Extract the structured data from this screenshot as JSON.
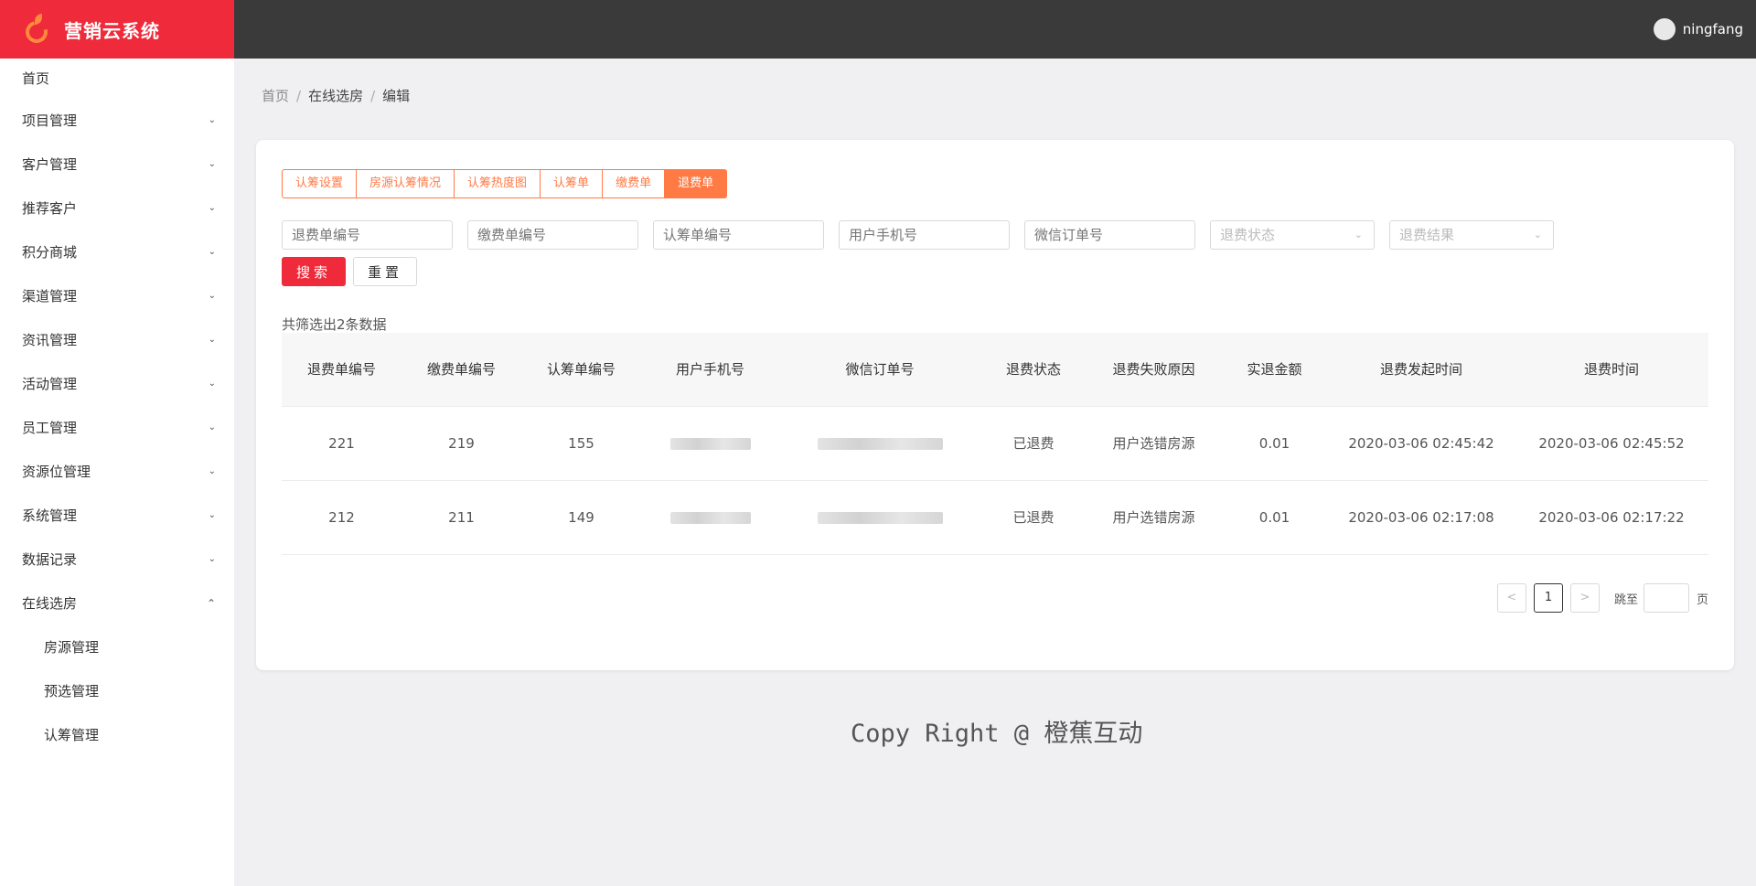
{
  "app": {
    "title": "营销云系统"
  },
  "user": {
    "name": "ningfang"
  },
  "sidebar": {
    "items": [
      {
        "label": "首页"
      },
      {
        "label": "项目管理"
      },
      {
        "label": "客户管理"
      },
      {
        "label": "推荐客户"
      },
      {
        "label": "积分商城"
      },
      {
        "label": "渠道管理"
      },
      {
        "label": "资讯管理"
      },
      {
        "label": "活动管理"
      },
      {
        "label": "员工管理"
      },
      {
        "label": "资源位管理"
      },
      {
        "label": "系统管理"
      },
      {
        "label": "数据记录"
      },
      {
        "label": "在线选房"
      }
    ],
    "subitems": [
      {
        "label": "房源管理"
      },
      {
        "label": "预选管理"
      },
      {
        "label": "认筹管理"
      }
    ]
  },
  "breadcrumb": {
    "home": "首页",
    "section": "在线选房",
    "current": "编辑",
    "sep": "/"
  },
  "tabs": [
    {
      "label": "认筹设置"
    },
    {
      "label": "房源认筹情况"
    },
    {
      "label": "认筹热度图"
    },
    {
      "label": "认筹单"
    },
    {
      "label": "缴费单"
    },
    {
      "label": "退费单"
    }
  ],
  "filters": {
    "refund_no": "退费单编号",
    "payment_no": "缴费单编号",
    "subscription_no": "认筹单编号",
    "phone": "用户手机号",
    "wechat_order": "微信订单号",
    "refund_status": "退费状态",
    "refund_result": "退费结果"
  },
  "buttons": {
    "search": "搜索",
    "reset": "重置"
  },
  "summary": "共筛选出2条数据",
  "table": {
    "headers": [
      "退费单编号",
      "缴费单编号",
      "认筹单编号",
      "用户手机号",
      "微信订单号",
      "退费状态",
      "退费失败原因",
      "实退金额",
      "退费发起时间",
      "退费时间"
    ],
    "rows": [
      {
        "refund_no": "221",
        "payment_no": "219",
        "subscription_no": "155",
        "status": "已退费",
        "reason": "用户选错房源",
        "amount": "0.01",
        "start_time": "2020-03-06 02:45:42",
        "refund_time": "2020-03-06 02:45:52"
      },
      {
        "refund_no": "212",
        "payment_no": "211",
        "subscription_no": "149",
        "status": "已退费",
        "reason": "用户选错房源",
        "amount": "0.01",
        "start_time": "2020-03-06 02:17:08",
        "refund_time": "2020-03-06 02:17:22"
      }
    ]
  },
  "pagination": {
    "prev": "<",
    "current": "1",
    "next": ">",
    "jump_label": "跳至",
    "page_unit": "页"
  },
  "footer": "Copy Right @ 橙蕉互动"
}
